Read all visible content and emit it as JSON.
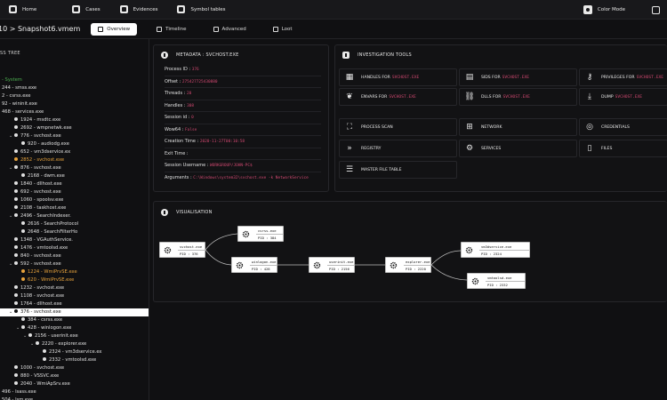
{
  "nav": {
    "home": "Home",
    "cases": "Cases",
    "evidences": "Evidences",
    "symbol_tables": "Symbol tables",
    "color_mode": "Color Mode"
  },
  "tabs": {
    "breadcrumb": "10 > Snapshot6.vmem",
    "overview": "Overview",
    "timeline": "Timeline",
    "advanced": "Advanced",
    "loot": "Loot"
  },
  "tree": {
    "header": "SS TREE",
    "rows": [
      {
        "label": "- System",
        "indent": 0,
        "chev": "",
        "dot": false,
        "state": "green"
      },
      {
        "label": "244 - smss.exe",
        "indent": 0,
        "chev": "",
        "dot": false,
        "state": ""
      },
      {
        "label": "2 - csrss.exe",
        "indent": 0,
        "chev": "",
        "dot": false,
        "state": ""
      },
      {
        "label": "92 - wininit.exe",
        "indent": 0,
        "chev": "",
        "dot": false,
        "state": ""
      },
      {
        "label": "468 - services.exe",
        "indent": 0,
        "chev": "",
        "dot": false,
        "state": ""
      },
      {
        "label": "1924 - msdtc.exe",
        "indent": 1,
        "chev": "",
        "dot": true,
        "state": ""
      },
      {
        "label": "2692 - wmpnetwk.exe",
        "indent": 1,
        "chev": "",
        "dot": true,
        "state": ""
      },
      {
        "label": "776 - svchost.exe",
        "indent": 1,
        "chev": "v",
        "dot": true,
        "state": ""
      },
      {
        "label": "920 - audiodg.exe",
        "indent": 2,
        "chev": "",
        "dot": true,
        "state": ""
      },
      {
        "label": "652 - vm3dservice.ex",
        "indent": 1,
        "chev": "",
        "dot": true,
        "state": ""
      },
      {
        "label": "2852 - svchost.exe",
        "indent": 1,
        "chev": "",
        "dot": true,
        "state": "hl"
      },
      {
        "label": "876 - svchost.exe",
        "indent": 1,
        "chev": "v",
        "dot": true,
        "state": ""
      },
      {
        "label": "2168 - dwm.exe",
        "indent": 2,
        "chev": "",
        "dot": true,
        "state": ""
      },
      {
        "label": "1840 - dllhost.exe",
        "indent": 1,
        "chev": "",
        "dot": true,
        "state": ""
      },
      {
        "label": "692 - svchost.exe",
        "indent": 1,
        "chev": "",
        "dot": true,
        "state": ""
      },
      {
        "label": "1060 - spoolsv.exe",
        "indent": 1,
        "chev": "",
        "dot": true,
        "state": ""
      },
      {
        "label": "2108 - taskhost.exe",
        "indent": 1,
        "chev": "",
        "dot": true,
        "state": ""
      },
      {
        "label": "2496 - SearchIndexer.",
        "indent": 1,
        "chev": "v",
        "dot": true,
        "state": ""
      },
      {
        "label": "2616 - SearchProtocol",
        "indent": 2,
        "chev": "",
        "dot": true,
        "state": ""
      },
      {
        "label": "2648 - SearchFilterHo",
        "indent": 2,
        "chev": "",
        "dot": true,
        "state": ""
      },
      {
        "label": "1348 - VGAuthService.",
        "indent": 1,
        "chev": "",
        "dot": true,
        "state": ""
      },
      {
        "label": "1476 - vmtoolsd.exe",
        "indent": 1,
        "chev": "",
        "dot": true,
        "state": ""
      },
      {
        "label": "840 - svchost.exe",
        "indent": 1,
        "chev": "",
        "dot": true,
        "state": ""
      },
      {
        "label": "592 - svchost.exe",
        "indent": 1,
        "chev": "v",
        "dot": true,
        "state": ""
      },
      {
        "label": "1224 - WmiPrvSE.exe",
        "indent": 2,
        "chev": "",
        "dot": true,
        "state": "hl"
      },
      {
        "label": "620 - WmiPrvSE.exe",
        "indent": 2,
        "chev": "",
        "dot": true,
        "state": "hl"
      },
      {
        "label": "1232 - svchost.exe",
        "indent": 1,
        "chev": "",
        "dot": true,
        "state": ""
      },
      {
        "label": "1108 - svchost.exe",
        "indent": 1,
        "chev": "",
        "dot": true,
        "state": ""
      },
      {
        "label": "1764 - dllhost.exe",
        "indent": 1,
        "chev": "",
        "dot": true,
        "state": ""
      },
      {
        "label": "376 - svchost.exe",
        "indent": 1,
        "chev": "v",
        "dot": true,
        "state": "selected"
      },
      {
        "label": "384 - csrss.exe",
        "indent": 2,
        "chev": "",
        "dot": true,
        "state": ""
      },
      {
        "label": "428 - winlogon.exe",
        "indent": 2,
        "chev": "v",
        "dot": true,
        "state": ""
      },
      {
        "label": "2156 - userinit.exe",
        "indent": 3,
        "chev": "v",
        "dot": true,
        "state": ""
      },
      {
        "label": "2220 - explorer.exe",
        "indent": 4,
        "chev": "v",
        "dot": true,
        "state": ""
      },
      {
        "label": "2324 - vm3dservice.ex",
        "indent": 5,
        "chev": "",
        "dot": true,
        "state": ""
      },
      {
        "label": "2332 - vmtoolsd.exe",
        "indent": 5,
        "chev": "",
        "dot": true,
        "state": ""
      },
      {
        "label": "1000 - svchost.exe",
        "indent": 1,
        "chev": "",
        "dot": true,
        "state": ""
      },
      {
        "label": "880 - VSSVC.exe",
        "indent": 1,
        "chev": "",
        "dot": true,
        "state": ""
      },
      {
        "label": "2040 - WmiApSrv.exe",
        "indent": 1,
        "chev": "",
        "dot": true,
        "state": ""
      },
      {
        "label": "496 - lsass.exe",
        "indent": 0,
        "chev": "",
        "dot": false,
        "state": ""
      },
      {
        "label": "504 - lsm.exe",
        "indent": 0,
        "chev": "",
        "dot": false,
        "state": ""
      }
    ]
  },
  "metadata": {
    "title": "METADATA : SVCHOST.EXE",
    "rows": [
      {
        "k": "Process ID : ",
        "v": "376"
      },
      {
        "k": "Offset : ",
        "v": "275427725430880"
      },
      {
        "k": "Threads : ",
        "v": "20"
      },
      {
        "k": "Handles : ",
        "v": "308"
      },
      {
        "k": "Session id : ",
        "v": "0"
      },
      {
        "k": "Wow64 : ",
        "v": "False"
      },
      {
        "k": "Creation Time : ",
        "v": "2020-11-27T00:10:58"
      },
      {
        "k": "Exit Time : ",
        "v": ""
      },
      {
        "k": "Session Username : ",
        "v": "WORKGROUP/JOHN-PC$"
      },
      {
        "k": "Arguments : ",
        "v": "C:\\Windows\\system32\\svchost.exe -k NetworkService"
      }
    ]
  },
  "tools": {
    "title": "INVESTIGATION TOOLS",
    "handles": {
      "label": "HANDLES FOR ",
      "acc": "SVCHOST.EXE"
    },
    "sids": {
      "label": "SIDS FOR ",
      "acc": "SVCHOST.EXE"
    },
    "privileges": {
      "label": "PRIVILEGES FOR ",
      "acc": "SVCHOST.EXE"
    },
    "envars": {
      "label": "ENVARS FOR ",
      "acc": "SVCHOST.EXE"
    },
    "dlls": {
      "label": "DLLS FOR ",
      "acc": "SVCHOST.EXE"
    },
    "dump": {
      "label": "DUMP ",
      "acc": "SVCHOST.EXE"
    },
    "process_scan": "PROCESS SCAN",
    "network": "NETWORK",
    "credentials": "CREDENTIALS",
    "registry": "REGISTRY",
    "services": "SERVICES",
    "files": "FILES",
    "mft": "MASTER FILE TABLE"
  },
  "visualisation": {
    "title": "VISUALISATION",
    "nodes": {
      "svchost": {
        "name": "svchost.exe",
        "pid": "PID : 376"
      },
      "csrss": {
        "name": "csrss.exe",
        "pid": "PID : 384"
      },
      "winlogon": {
        "name": "winlogon.exe",
        "pid": "PID : 428"
      },
      "userinit": {
        "name": "userinit.exe",
        "pid": "PID : 2156"
      },
      "explorer": {
        "name": "explorer.exe",
        "pid": "PID : 2220"
      },
      "vm3dservice": {
        "name": "vm3dservice.exe",
        "pid": "PID : 2324"
      },
      "vmtoolsd": {
        "name": "vmtoolsd.exe",
        "pid": "PID : 2332"
      }
    }
  }
}
